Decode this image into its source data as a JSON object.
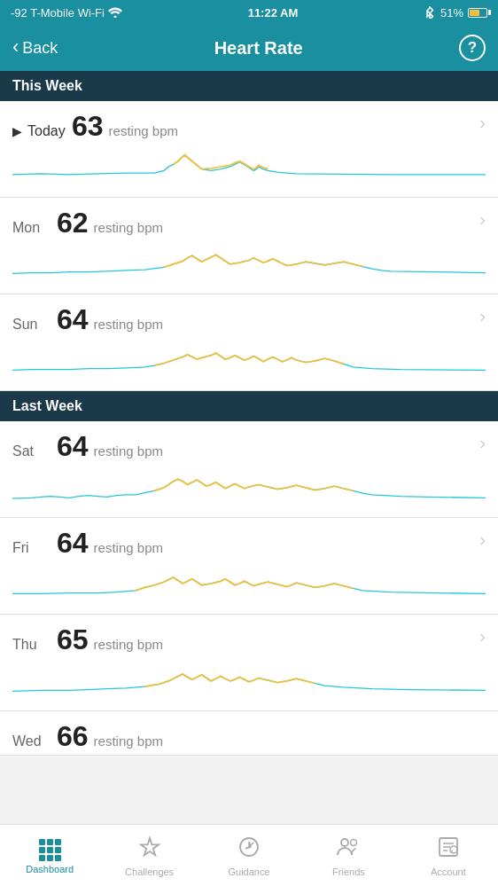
{
  "statusBar": {
    "carrier": "-92 T-Mobile Wi-Fi",
    "time": "11:22 AM",
    "batteryPercent": "51%"
  },
  "header": {
    "backLabel": "Back",
    "title": "Heart Rate",
    "helpLabel": "?"
  },
  "sections": [
    {
      "label": "This Week",
      "days": [
        {
          "day": "Today",
          "isToday": true,
          "bpm": "63",
          "unit": "resting bpm",
          "chartType": "today"
        },
        {
          "day": "Mon",
          "isToday": false,
          "bpm": "62",
          "unit": "resting bpm",
          "chartType": "mon"
        },
        {
          "day": "Sun",
          "isToday": false,
          "bpm": "64",
          "unit": "resting bpm",
          "chartType": "sun"
        }
      ]
    },
    {
      "label": "Last Week",
      "days": [
        {
          "day": "Sat",
          "isToday": false,
          "bpm": "64",
          "unit": "resting bpm",
          "chartType": "sat"
        },
        {
          "day": "Fri",
          "isToday": false,
          "bpm": "64",
          "unit": "resting bpm",
          "chartType": "fri"
        },
        {
          "day": "Thu",
          "isToday": false,
          "bpm": "65",
          "unit": "resting bpm",
          "chartType": "thu"
        },
        {
          "day": "Wed",
          "isToday": false,
          "bpm": "66",
          "unit": "resting bpm",
          "chartType": "wed"
        }
      ]
    }
  ],
  "tabBar": {
    "items": [
      {
        "id": "dashboard",
        "label": "Dashboard",
        "active": true
      },
      {
        "id": "challenges",
        "label": "Challenges",
        "active": false
      },
      {
        "id": "guidance",
        "label": "Guidance",
        "active": false
      },
      {
        "id": "friends",
        "label": "Friends",
        "active": false
      },
      {
        "id": "account",
        "label": "Account",
        "active": false
      }
    ]
  }
}
